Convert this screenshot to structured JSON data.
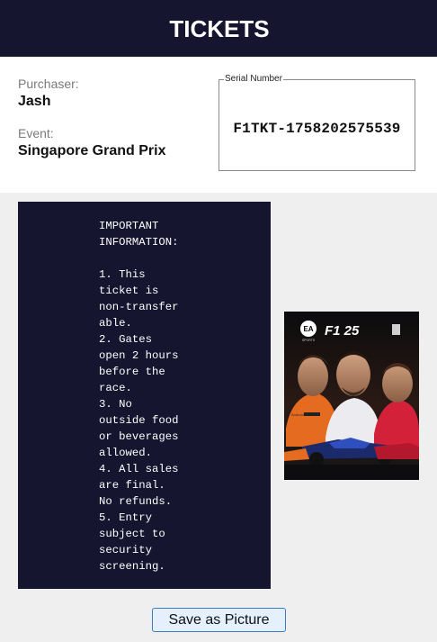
{
  "header": {
    "title": "TICKETS"
  },
  "ticket": {
    "purchaser_label": "Purchaser:",
    "purchaser": "Jash",
    "event_label": "Event:",
    "event": "Singapore Grand Prix",
    "serial_label": "Serial Number",
    "serial": "F1TKT-1758202575539"
  },
  "notice": {
    "lines": [
      "IMPORTANT",
      "INFORMATION:",
      "",
      "1. This",
      "ticket is",
      "non-transfer",
      "able.",
      "2. Gates",
      "open 2 hours",
      "before the",
      "race.",
      "3. No",
      "outside food",
      "or beverages",
      "allowed.",
      "4. All sales",
      "are final.",
      "No refunds.",
      "5. Entry",
      "subject to",
      "security",
      "screening."
    ]
  },
  "cover": {
    "publisher_badge": "EA",
    "publisher_sub": "SPORTS",
    "game_title": "F1 25",
    "sponsor_text": "Android"
  },
  "actions": {
    "save_label": "Save as Picture"
  },
  "colors": {
    "navy": "#151530",
    "button_bg": "#e4f0fb",
    "button_border": "#3b7cbf"
  }
}
